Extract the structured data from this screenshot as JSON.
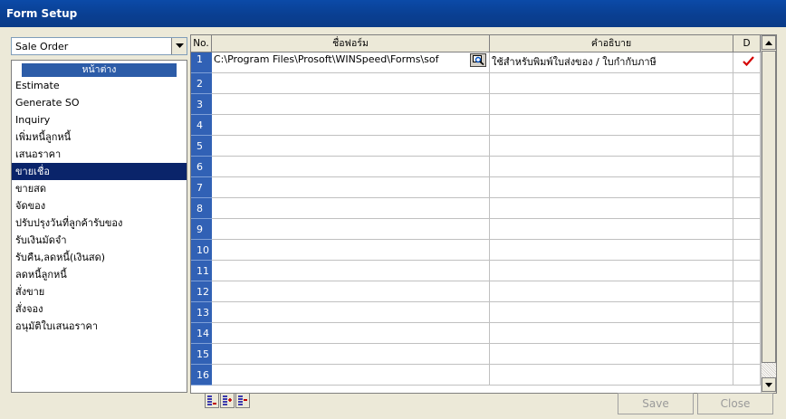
{
  "window": {
    "title": "Form Setup"
  },
  "left": {
    "selector_value": "Sale Order",
    "list_header": "หน้าต่าง",
    "items": [
      "Estimate",
      "Generate SO",
      "Inquiry",
      "เพิ่มหนี้ลูกหนี้",
      "เสนอราคา",
      "ขายเชื่อ",
      "ขายสด",
      "จัดของ",
      "ปรับปรุงวันที่ลูกค้ารับของ",
      "รับเงินมัดจำ",
      "รับคืน,ลดหนี้(เงินสด)",
      "ลดหนี้ลูกหนี้",
      "สั่งขาย",
      "สั่งจอง",
      "อนุมัติใบเสนอราคา"
    ],
    "selected_index": 5
  },
  "grid": {
    "columns": {
      "no": "No.",
      "form_name": "ชื่อฟอร์ม",
      "description": "คำอธิบาย",
      "d": "D"
    },
    "row_numbers": [
      "1",
      "2",
      "3",
      "4",
      "5",
      "6",
      "7",
      "8",
      "9",
      "10",
      "11",
      "12",
      "13",
      "14",
      "15",
      "16"
    ],
    "rows": [
      {
        "form_name": "C:\\Program Files\\Prosoft\\WINSpeed\\Forms\\sof",
        "description": "ใช้สำหรับพิมพ์ใบส่งของ / ใบกำกับภาษี",
        "d_checked": true
      }
    ]
  },
  "buttons": {
    "save": "Save",
    "close": "Close"
  },
  "colors": {
    "title_bar": "#0a3f92",
    "row_number_bg": "#3161b5",
    "selection": "#0a246a",
    "check": "#d40000"
  },
  "icons": {
    "browse": "magnifier-icon",
    "toolbar": [
      "insert-row-icon",
      "append-row-icon",
      "delete-row-icon"
    ]
  }
}
